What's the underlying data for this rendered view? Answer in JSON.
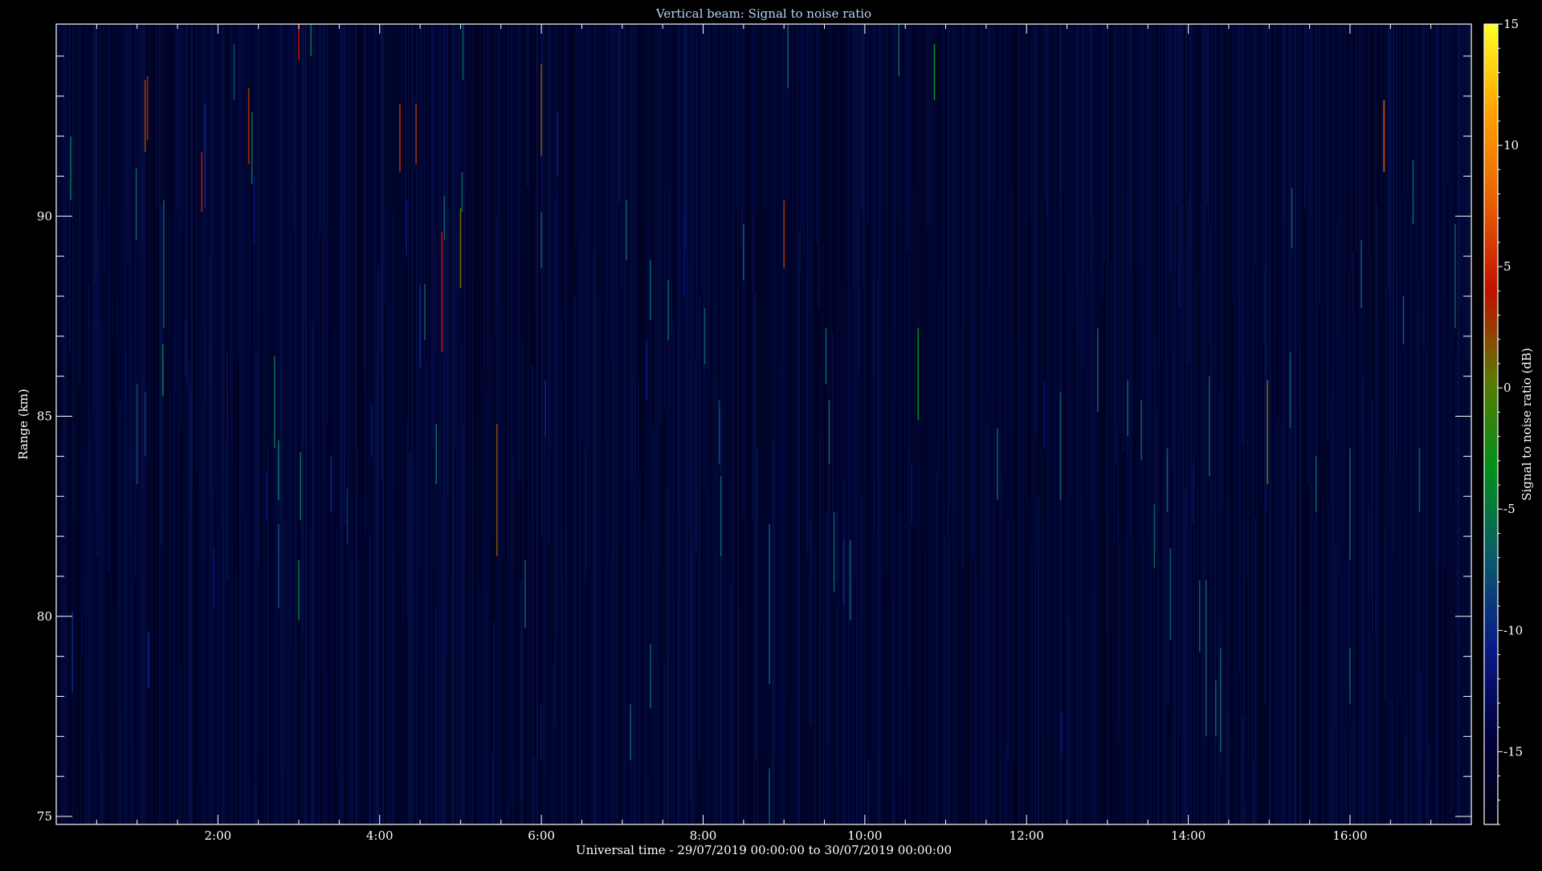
{
  "chart_data": {
    "type": "heatmap",
    "title": "Vertical beam: Signal to noise ratio",
    "xlabel": "Universal time - 29/07/2019 00:00:00 to 30/07/2019 00:00:00",
    "ylabel": "Range (km)",
    "xlim": [
      0.0,
      17.5
    ],
    "ylim": [
      74.8,
      94.8
    ],
    "x_ticks": [
      {
        "value": 2,
        "label": "2:00"
      },
      {
        "value": 4,
        "label": "4:00"
      },
      {
        "value": 6,
        "label": "6:00"
      },
      {
        "value": 8,
        "label": "8:00"
      },
      {
        "value": 10,
        "label": "10:00"
      },
      {
        "value": 12,
        "label": "12:00"
      },
      {
        "value": 14,
        "label": "14:00"
      },
      {
        "value": 16,
        "label": "16:00"
      }
    ],
    "y_ticks": [
      {
        "value": 75,
        "label": "75"
      },
      {
        "value": 80,
        "label": "80"
      },
      {
        "value": 85,
        "label": "85"
      },
      {
        "value": 90,
        "label": "90"
      }
    ],
    "colorbar": {
      "label": "Signal to noise ratio (dB)",
      "range": [
        -18,
        15
      ],
      "ticks": [
        {
          "value": 15,
          "label": "15"
        },
        {
          "value": 10,
          "label": "10"
        },
        {
          "value": 5,
          "label": "5"
        },
        {
          "value": 0,
          "label": "0"
        },
        {
          "value": -5,
          "label": "-5"
        },
        {
          "value": -10,
          "label": "-10"
        },
        {
          "value": -15,
          "label": "-15"
        }
      ],
      "colors": [
        "#000010",
        "#00003c",
        "#0a1a8a",
        "#0b5a6a",
        "#00901a",
        "#5a7a00",
        "#c01000",
        "#e86000",
        "#ffa000",
        "#ffff20"
      ]
    },
    "background_snr": -16,
    "echoes": [
      {
        "t": 0.18,
        "r0": 90.4,
        "r1": 92.0,
        "snr": -6
      },
      {
        "t": 0.2,
        "r0": 78.1,
        "r1": 80.1,
        "snr": -10
      },
      {
        "t": 0.6,
        "r0": 88.6,
        "r1": 90.3,
        "snr": -13
      },
      {
        "t": 0.86,
        "r0": 85.0,
        "r1": 86.6,
        "snr": -13
      },
      {
        "t": 0.99,
        "r0": 89.4,
        "r1": 91.2,
        "snr": -7
      },
      {
        "t": 1.0,
        "r0": 83.3,
        "r1": 85.8,
        "snr": -8
      },
      {
        "t": 1.1,
        "r0": 91.6,
        "r1": 93.4,
        "snr": 2
      },
      {
        "t": 1.13,
        "r0": 91.9,
        "r1": 93.5,
        "snr": 4
      },
      {
        "t": 1.1,
        "r0": 84.0,
        "r1": 85.6,
        "snr": -9
      },
      {
        "t": 1.14,
        "r0": 78.2,
        "r1": 79.6,
        "snr": -10
      },
      {
        "t": 1.32,
        "r0": 85.5,
        "r1": 86.8,
        "snr": -5
      },
      {
        "t": 1.33,
        "r0": 87.2,
        "r1": 90.4,
        "snr": -7
      },
      {
        "t": 1.6,
        "r0": 86.0,
        "r1": 87.4,
        "snr": -12
      },
      {
        "t": 1.8,
        "r0": 90.1,
        "r1": 91.6,
        "snr": 4
      },
      {
        "t": 1.84,
        "r0": 90.2,
        "r1": 92.8,
        "snr": -10
      },
      {
        "t": 1.95,
        "r0": 80.2,
        "r1": 81.7,
        "snr": -12
      },
      {
        "t": 2.2,
        "r0": 92.9,
        "r1": 94.3,
        "snr": -8
      },
      {
        "t": 2.38,
        "r0": 91.3,
        "r1": 93.2,
        "snr": 3
      },
      {
        "t": 2.42,
        "r0": 90.8,
        "r1": 92.6,
        "snr": -6
      },
      {
        "t": 2.45,
        "r0": 89.3,
        "r1": 91.0,
        "snr": -12
      },
      {
        "t": 2.6,
        "r0": 82.4,
        "r1": 83.6,
        "snr": -12
      },
      {
        "t": 2.7,
        "r0": 84.2,
        "r1": 86.5,
        "snr": -6
      },
      {
        "t": 2.75,
        "r0": 82.9,
        "r1": 84.4,
        "snr": -6
      },
      {
        "t": 2.75,
        "r0": 80.2,
        "r1": 82.3,
        "snr": -8
      },
      {
        "t": 3.0,
        "r0": 93.9,
        "r1": 94.8,
        "snr": 4
      },
      {
        "t": 3.0,
        "r0": 79.9,
        "r1": 81.4,
        "snr": -5
      },
      {
        "t": 3.02,
        "r0": 82.4,
        "r1": 84.1,
        "snr": -6
      },
      {
        "t": 3.15,
        "r0": 94.0,
        "r1": 94.8,
        "snr": -6
      },
      {
        "t": 3.4,
        "r0": 82.6,
        "r1": 84.0,
        "snr": -10
      },
      {
        "t": 3.6,
        "r0": 81.8,
        "r1": 83.2,
        "snr": -9
      },
      {
        "t": 3.9,
        "r0": 84.0,
        "r1": 85.3,
        "snr": -11
      },
      {
        "t": 4.25,
        "r0": 91.1,
        "r1": 92.8,
        "snr": 5
      },
      {
        "t": 4.33,
        "r0": 89.0,
        "r1": 90.4,
        "snr": -11
      },
      {
        "t": 4.45,
        "r0": 91.3,
        "r1": 92.8,
        "snr": 3
      },
      {
        "t": 4.5,
        "r0": 86.2,
        "r1": 88.3,
        "snr": -10
      },
      {
        "t": 4.56,
        "r0": 86.9,
        "r1": 88.3,
        "snr": -7
      },
      {
        "t": 4.7,
        "r0": 83.3,
        "r1": 84.8,
        "snr": -6
      },
      {
        "t": 4.77,
        "r0": 86.6,
        "r1": 89.6,
        "snr": 4
      },
      {
        "t": 4.8,
        "r0": 89.4,
        "r1": 90.5,
        "snr": -7
      },
      {
        "t": 4.96,
        "r0": 91.0,
        "r1": 93.4,
        "snr": -13
      },
      {
        "t": 5.0,
        "r0": 88.2,
        "r1": 90.2,
        "snr": 1
      },
      {
        "t": 5.02,
        "r0": 90.1,
        "r1": 91.1,
        "snr": -7
      },
      {
        "t": 5.03,
        "r0": 93.4,
        "r1": 94.8,
        "snr": -7
      },
      {
        "t": 5.45,
        "r0": 81.5,
        "r1": 84.8,
        "snr": 2
      },
      {
        "t": 5.8,
        "r0": 79.7,
        "r1": 81.4,
        "snr": -7
      },
      {
        "t": 6.0,
        "r0": 91.5,
        "r1": 93.8,
        "snr": 2
      },
      {
        "t": 6.0,
        "r0": 88.7,
        "r1": 90.1,
        "snr": -7
      },
      {
        "t": 6.05,
        "r0": 84.5,
        "r1": 85.9,
        "snr": -10
      },
      {
        "t": 6.0,
        "r0": 76.4,
        "r1": 77.8,
        "snr": -12
      },
      {
        "t": 6.2,
        "r0": 91.0,
        "r1": 92.6,
        "snr": -11
      },
      {
        "t": 7.05,
        "r0": 88.9,
        "r1": 90.4,
        "snr": -7
      },
      {
        "t": 7.1,
        "r0": 76.4,
        "r1": 77.8,
        "snr": -7
      },
      {
        "t": 7.3,
        "r0": 85.4,
        "r1": 86.9,
        "snr": -11
      },
      {
        "t": 7.35,
        "r0": 87.4,
        "r1": 88.9,
        "snr": -7
      },
      {
        "t": 7.35,
        "r0": 77.7,
        "r1": 79.3,
        "snr": -7
      },
      {
        "t": 7.57,
        "r0": 86.9,
        "r1": 88.4,
        "snr": -7
      },
      {
        "t": 7.77,
        "r0": 88.0,
        "r1": 90.1,
        "snr": -12
      },
      {
        "t": 8.02,
        "r0": 86.3,
        "r1": 87.7,
        "snr": -7
      },
      {
        "t": 8.2,
        "r0": 83.8,
        "r1": 85.4,
        "snr": -8
      },
      {
        "t": 8.22,
        "r0": 81.5,
        "r1": 83.5,
        "snr": -7
      },
      {
        "t": 8.5,
        "r0": 88.4,
        "r1": 89.8,
        "snr": -7
      },
      {
        "t": 8.82,
        "r0": 78.3,
        "r1": 82.3,
        "snr": -7
      },
      {
        "t": 8.82,
        "r0": 74.8,
        "r1": 76.2,
        "snr": -7
      },
      {
        "t": 9.0,
        "r0": 88.7,
        "r1": 90.4,
        "snr": 3
      },
      {
        "t": 9.05,
        "r0": 93.2,
        "r1": 94.8,
        "snr": -7
      },
      {
        "t": 9.52,
        "r0": 85.8,
        "r1": 87.2,
        "snr": -7
      },
      {
        "t": 9.56,
        "r0": 83.8,
        "r1": 85.4,
        "snr": -7
      },
      {
        "t": 9.62,
        "r0": 80.6,
        "r1": 82.6,
        "snr": -7
      },
      {
        "t": 9.66,
        "r0": 80.9,
        "r1": 82.6,
        "snr": -12
      },
      {
        "t": 9.74,
        "r0": 80.3,
        "r1": 81.9,
        "snr": -10
      },
      {
        "t": 9.82,
        "r0": 79.9,
        "r1": 81.9,
        "snr": -7
      },
      {
        "t": 10.42,
        "r0": 93.5,
        "r1": 94.8,
        "snr": -7
      },
      {
        "t": 10.58,
        "r0": 82.3,
        "r1": 83.8,
        "snr": -12
      },
      {
        "t": 10.66,
        "r0": 84.9,
        "r1": 87.2,
        "snr": -4
      },
      {
        "t": 10.86,
        "r0": 92.9,
        "r1": 94.3,
        "snr": -3
      },
      {
        "t": 11.64,
        "r0": 82.9,
        "r1": 84.7,
        "snr": -7
      },
      {
        "t": 12.22,
        "r0": 84.2,
        "r1": 85.9,
        "snr": -12
      },
      {
        "t": 12.42,
        "r0": 82.9,
        "r1": 85.6,
        "snr": -7
      },
      {
        "t": 12.44,
        "r0": 76.6,
        "r1": 77.6,
        "snr": -12
      },
      {
        "t": 12.88,
        "r0": 85.1,
        "r1": 87.2,
        "snr": -7
      },
      {
        "t": 13.25,
        "r0": 84.5,
        "r1": 85.9,
        "snr": -7
      },
      {
        "t": 13.42,
        "r0": 83.9,
        "r1": 85.4,
        "snr": -7
      },
      {
        "t": 13.58,
        "r0": 81.2,
        "r1": 82.8,
        "snr": -7
      },
      {
        "t": 13.74,
        "r0": 82.6,
        "r1": 84.2,
        "snr": -7
      },
      {
        "t": 13.78,
        "r0": 79.4,
        "r1": 81.7,
        "snr": -7
      },
      {
        "t": 14.06,
        "r0": 82.3,
        "r1": 83.8,
        "snr": -12
      },
      {
        "t": 14.14,
        "r0": 79.1,
        "r1": 80.9,
        "snr": -7
      },
      {
        "t": 14.22,
        "r0": 77.0,
        "r1": 80.9,
        "snr": -7
      },
      {
        "t": 14.26,
        "r0": 83.5,
        "r1": 86.0,
        "snr": -7
      },
      {
        "t": 14.34,
        "r0": 77.0,
        "r1": 78.4,
        "snr": -7
      },
      {
        "t": 14.4,
        "r0": 76.6,
        "r1": 79.2,
        "snr": -7
      },
      {
        "t": 14.98,
        "r0": 83.3,
        "r1": 85.9,
        "snr": 1
      },
      {
        "t": 15.26,
        "r0": 84.7,
        "r1": 86.6,
        "snr": -7
      },
      {
        "t": 15.28,
        "r0": 89.2,
        "r1": 90.7,
        "snr": -7
      },
      {
        "t": 15.58,
        "r0": 82.6,
        "r1": 84.0,
        "snr": -7
      },
      {
        "t": 16.0,
        "r0": 81.4,
        "r1": 84.2,
        "snr": -7
      },
      {
        "t": 16.0,
        "r0": 77.8,
        "r1": 79.2,
        "snr": -7
      },
      {
        "t": 16.14,
        "r0": 87.7,
        "r1": 89.4,
        "snr": -7
      },
      {
        "t": 16.42,
        "r0": 91.1,
        "r1": 92.9,
        "snr": 7
      },
      {
        "t": 16.66,
        "r0": 86.8,
        "r1": 88.0,
        "snr": -7
      },
      {
        "t": 16.78,
        "r0": 89.8,
        "r1": 91.4,
        "snr": -7
      },
      {
        "t": 16.86,
        "r0": 82.6,
        "r1": 84.2,
        "snr": -7
      },
      {
        "t": 17.3,
        "r0": 87.2,
        "r1": 89.8,
        "snr": -7
      }
    ]
  }
}
